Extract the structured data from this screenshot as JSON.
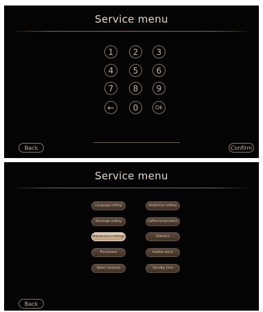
{
  "screen1": {
    "title": "Service menu",
    "keypad": [
      [
        "1",
        "2",
        "3"
      ],
      [
        "4",
        "5",
        "6"
      ],
      [
        "7",
        "8",
        "9"
      ],
      [
        "←",
        "0",
        "Ok"
      ]
    ],
    "back_label": "Back",
    "confirm_label": "Confirm"
  },
  "screen2": {
    "title": "Service menu",
    "settings_left": [
      {
        "label": "Language setting",
        "active": false
      },
      {
        "label": "Beverage setting",
        "active": false
      },
      {
        "label": "Maintenance settings",
        "active": true
      },
      {
        "label": "Pre-brewed",
        "active": false
      },
      {
        "label": "Water hardness",
        "active": false
      }
    ],
    "settings_right": [
      {
        "label": "Brightness setting",
        "active": false
      },
      {
        "label": "Coffee temperature",
        "active": false
      },
      {
        "label": "Statistics",
        "active": false
      },
      {
        "label": "Audible alarm",
        "active": false
      },
      {
        "label": "Standby time",
        "active": false
      }
    ],
    "back_label": "Back"
  },
  "colors": {
    "background": "#040404",
    "accent": "#8d7360",
    "text": "#e6d6c6",
    "active_button": "#d9c0a4"
  }
}
